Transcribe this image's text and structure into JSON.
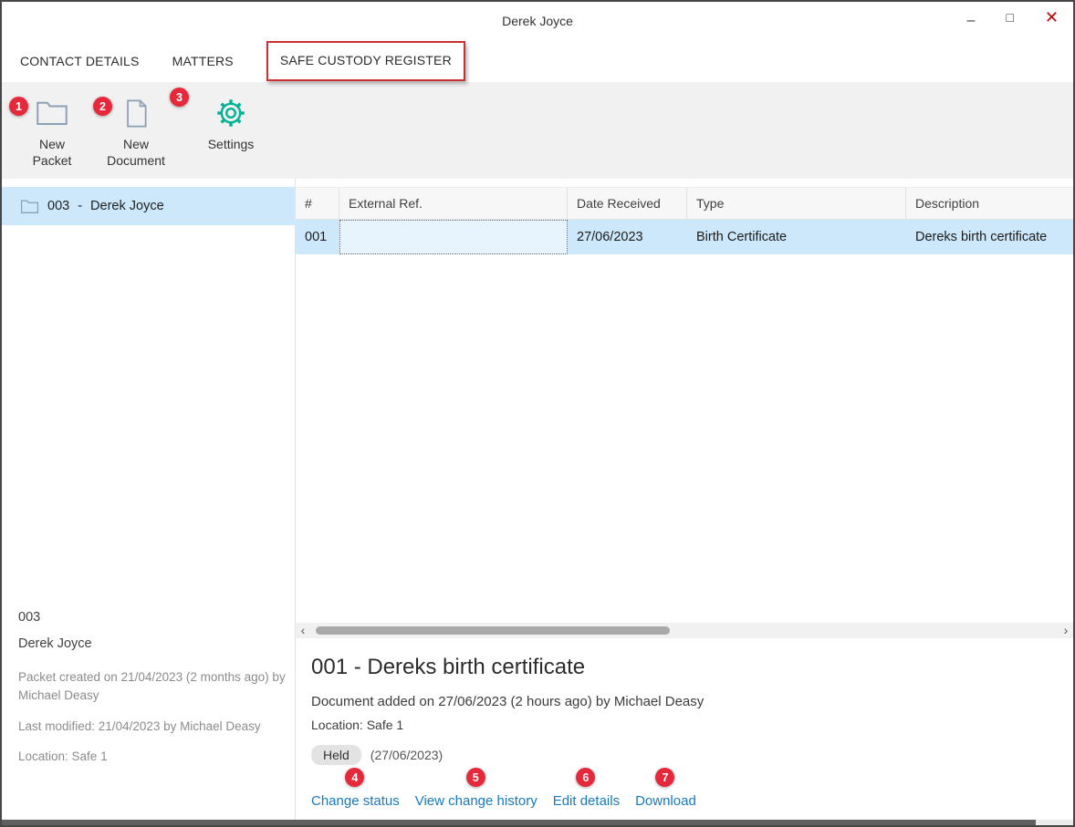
{
  "window": {
    "title": "Derek Joyce",
    "controls": {
      "minimize": "–",
      "maximize": "□",
      "close": "✕"
    }
  },
  "tabs": [
    {
      "label": "CONTACT DETAILS"
    },
    {
      "label": "MATTERS"
    },
    {
      "label": "SAFE CUSTODY REGISTER"
    }
  ],
  "toolbar": [
    {
      "label": "New Packet",
      "icon": "new-packet-folder-icon",
      "badge": "1"
    },
    {
      "label": "New Document",
      "icon": "new-document-icon",
      "badge": "2"
    },
    {
      "label": "Settings",
      "icon": "settings-gear-icon",
      "badge": "3"
    }
  ],
  "sidebar": {
    "selected_packet": {
      "code": "003",
      "separator": "-",
      "name": "Derek Joyce"
    },
    "details": {
      "code": "003",
      "name": "Derek Joyce",
      "created": "Packet created on 21/04/2023 (2 months ago) by Michael Deasy",
      "modified": "Last modified: 21/04/2023 by Michael Deasy",
      "location": "Location: Safe 1"
    }
  },
  "table": {
    "columns": [
      "#",
      "External Ref.",
      "Date Received",
      "Type",
      "Description"
    ],
    "rows": [
      {
        "num": "001",
        "external_ref": "",
        "date_received": "27/06/2023",
        "type": "Birth Certificate",
        "description": "Dereks birth certificate"
      }
    ]
  },
  "scrollbar": {
    "left_arrow": "‹",
    "right_arrow": "›"
  },
  "document_detail": {
    "title": "001 - Dereks birth certificate",
    "added": "Document added on 27/06/2023 (2 hours ago) by Michael Deasy",
    "location": "Location: Safe 1",
    "status": "Held",
    "status_date": "(27/06/2023)",
    "actions": [
      {
        "label": "Change status",
        "badge": "4"
      },
      {
        "label": "View change history",
        "badge": "5"
      },
      {
        "label": "Edit details",
        "badge": "6"
      },
      {
        "label": "Download",
        "badge": "7"
      }
    ]
  },
  "colors": {
    "selection_blue": "#cde8fb",
    "link_blue": "#1878be",
    "annotation_red": "#e5293b",
    "settings_teal": "#00b294",
    "close_red": "#c40000"
  }
}
